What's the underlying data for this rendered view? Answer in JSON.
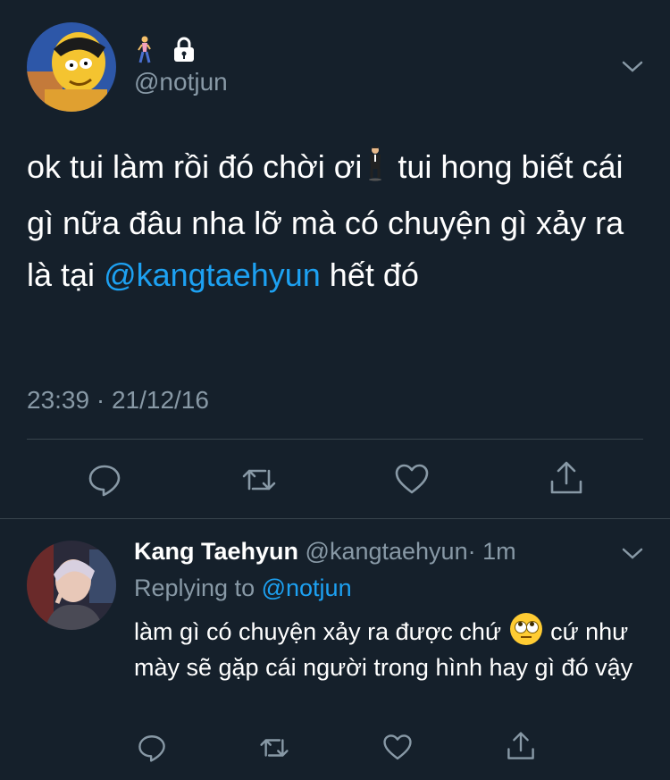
{
  "tweet": {
    "handle": "@notjun",
    "profile_icons": [
      "person-walking-icon",
      "lock-icon"
    ],
    "text_parts": [
      "ok tui làm rồi đó chời ơi",
      "tui hong biết cái gì nữa đâu nha lỡ mà có chuyện gì xảy ra là tại",
      "@kangtaehyun",
      "hết đó"
    ],
    "emoji": "man-in-business-suit-levitating-icon",
    "timestamp": "23:39 · 21/12/16"
  },
  "reply": {
    "name": "Kang Taehyun",
    "handle": "@kangtaehyun",
    "time": "· 1m",
    "replying_prefix": "Replying to",
    "replying_to": "@notjun",
    "text_before": "làm gì có chuyện xảy ra được chứ",
    "emoji": "face-with-rolling-eyes-icon",
    "text_after": "cứ như mày sẽ gặp cái người trong hình hay gì đó vậy"
  },
  "actions": [
    "reply-icon",
    "retweet-icon",
    "like-icon",
    "share-icon"
  ],
  "colors": {
    "background": "#15202b",
    "muted": "#8899a6",
    "link": "#1da1f2",
    "divider": "#38444d"
  }
}
